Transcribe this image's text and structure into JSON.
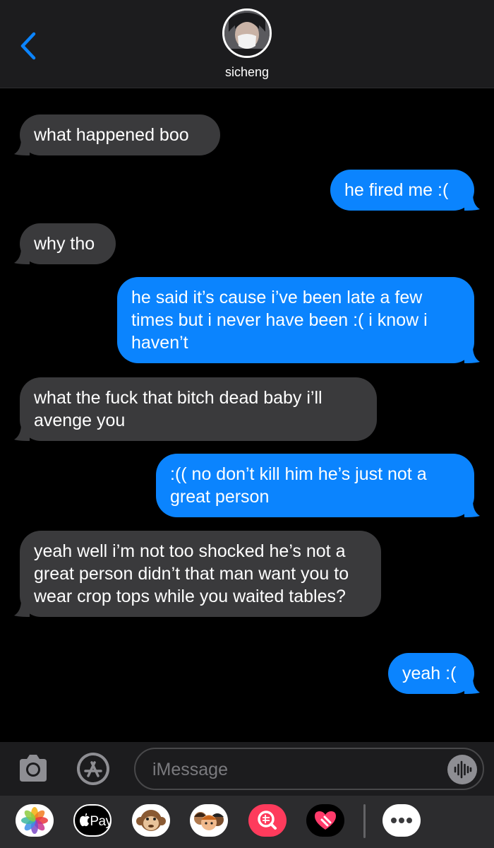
{
  "header": {
    "contact_name": "sicheng",
    "back_icon": "chevron-left-icon",
    "accent": "#0b84fe"
  },
  "messages": [
    {
      "from": "them",
      "text": "what happened boo"
    },
    {
      "from": "me",
      "text": "he fired me :("
    },
    {
      "from": "them",
      "text": "why tho"
    },
    {
      "from": "me",
      "text": "he said it’s cause i’ve been late a few times but i never have been :( i know i haven’t"
    },
    {
      "from": "them",
      "text": "what the fuck that bitch dead baby i’ll avenge you"
    },
    {
      "from": "me",
      "text": ":(( no don’t kill him he’s just not a great person"
    },
    {
      "from": "them",
      "text": "yeah well i’m not too shocked he’s not a great person didn’t that man want you to wear crop tops while you waited tables?"
    },
    {
      "from": "me",
      "text": "yeah :("
    }
  ],
  "colors": {
    "incoming_bubble": "#3a3a3c",
    "outgoing_bubble": "#0b84fe",
    "background": "#000000"
  },
  "input": {
    "placeholder": "iMessage",
    "camera_icon": "camera-icon",
    "apps_icon": "app-store-icon",
    "audio_icon": "audio-waveform-icon"
  },
  "drawer": {
    "apps": [
      {
        "name": "photos-icon"
      },
      {
        "name": "apple-pay-icon",
        "label": "Pay"
      },
      {
        "name": "animoji-monkey-icon"
      },
      {
        "name": "memoji-icon"
      },
      {
        "name": "image-search-icon"
      },
      {
        "name": "digital-touch-icon"
      },
      {
        "name": "more-icon"
      }
    ]
  }
}
